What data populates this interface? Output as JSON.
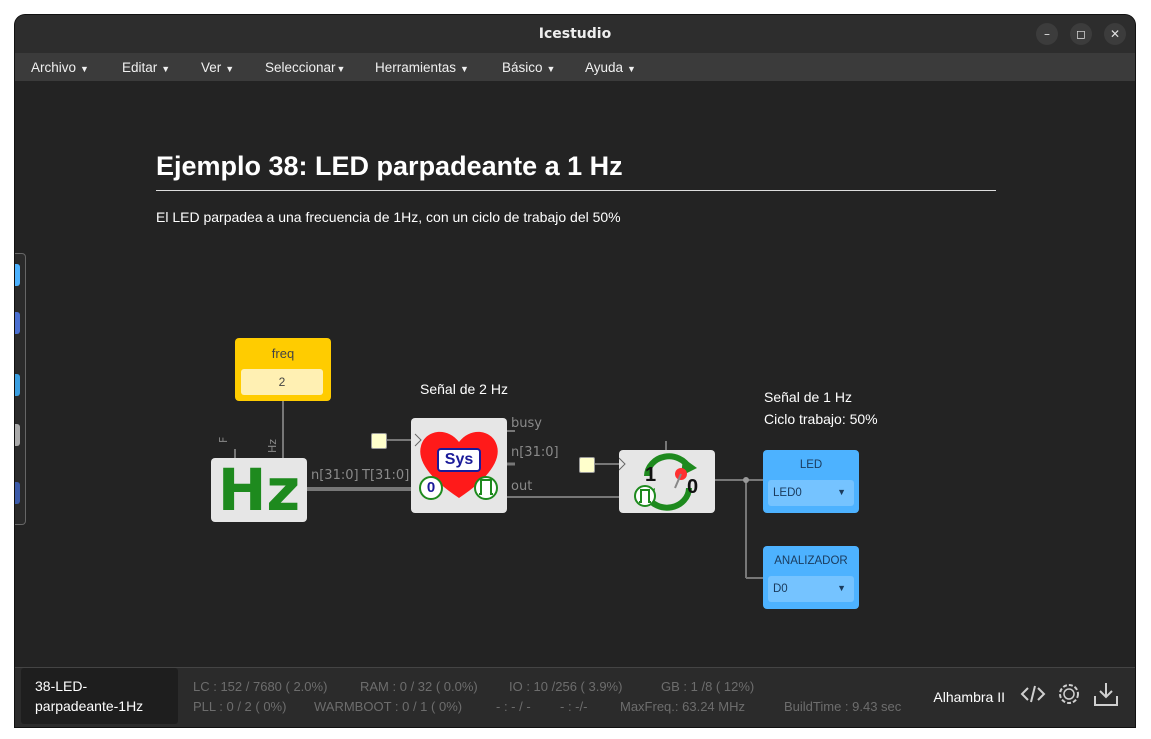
{
  "window": {
    "title": "Icestudio"
  },
  "menu": [
    {
      "label": "Archivo"
    },
    {
      "label": "Editar"
    },
    {
      "label": "Ver"
    },
    {
      "label": "Seleccionar"
    },
    {
      "label": "Herramientas"
    },
    {
      "label": "Básico"
    },
    {
      "label": "Ayuda"
    }
  ],
  "doc": {
    "title": "Ejemplo 38: LED parpadeante a 1 Hz",
    "description": "El LED parpadea a una frecuencia de 1Hz, con un ciclo de trabajo del 50%"
  },
  "circuit": {
    "signal_2hz": "Señal de 2 Hz",
    "signal_1hz": "Señal de 1 Hz",
    "duty": "Ciclo trabajo: 50%",
    "const_freq": {
      "name": "freq",
      "value": "2"
    },
    "hz_block": {
      "symbol": "Hz",
      "port_f": "F",
      "port_hz": "Hz",
      "port_n": "n[31:0]"
    },
    "sys_block": {
      "symbol": "Sys",
      "num": "0",
      "port_t": "T[31:0]",
      "port_busy": "busy",
      "port_n": "n[31:0]",
      "port_out": "out"
    },
    "toggle_block": {
      "one": "1",
      "zero": "0"
    },
    "led_block": {
      "name": "LED",
      "pin": "LED0"
    },
    "analyzer_block": {
      "name": "ANALIZADOR",
      "pin": "D0"
    },
    "colors": {
      "wire": "#777777",
      "const": "#ffcc00",
      "output": "#4db2ff",
      "block": "#e6e6e6",
      "green": "#1e8a1e",
      "heart": "#ff1a1a"
    }
  },
  "footer": {
    "file": "38-LED-parpadeante-1Hz",
    "stats": {
      "lc": "LC : 152 / 7680 ( 2.0%)",
      "ram": "RAM : 0 / 32 ( 0.0%)",
      "io": "IO : 10 /256 ( 3.9%)",
      "gb": "GB : 1 /8 ( 12%)",
      "pll": "PLL : 0 / 2 ( 0%)",
      "warmboot": "WARMBOOT : 0 / 1 ( 0%)",
      "blank1": "- : - / -",
      "blank2": "- : -/-",
      "maxfreq": "MaxFreq.: 63.24 MHz",
      "buildtime": "BuildTime : 9.43 sec"
    },
    "board": "Alhambra II"
  }
}
